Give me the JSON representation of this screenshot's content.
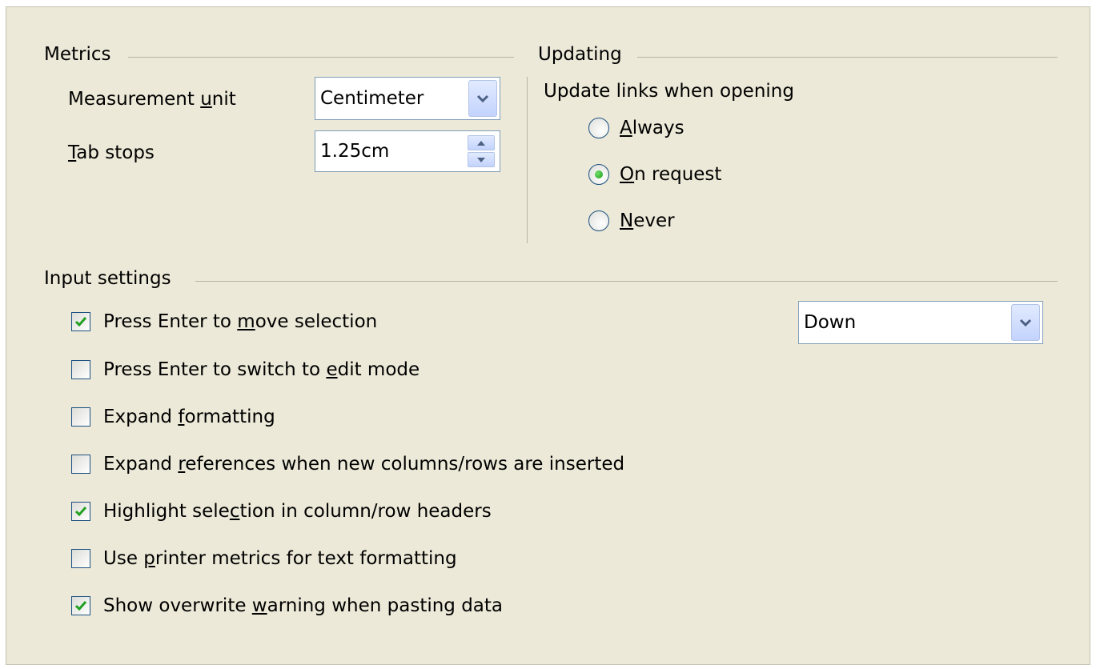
{
  "metrics": {
    "title": "Metrics",
    "measurement_unit": {
      "label_pre": "Measurement ",
      "label_u": "u",
      "label_post": "nit",
      "value": "Centimeter"
    },
    "tab_stops": {
      "label_pre": "",
      "label_u": "T",
      "label_post": "ab stops",
      "value": "1.25cm"
    }
  },
  "updating": {
    "title": "Updating",
    "question": "Update links when opening",
    "options": [
      {
        "pre": "",
        "u": "A",
        "post": "lways",
        "selected": false
      },
      {
        "pre": "",
        "u": "O",
        "post": "n request",
        "selected": true
      },
      {
        "pre": "",
        "u": "N",
        "post": "ever",
        "selected": false
      }
    ]
  },
  "input_settings": {
    "title": "Input settings",
    "direction_value": "Down",
    "options": [
      {
        "pre": "Press Enter to ",
        "u": "m",
        "post": "ove selection",
        "checked": true
      },
      {
        "pre": "Press Enter to switch to ",
        "u": "e",
        "post": "dit mode",
        "checked": false
      },
      {
        "pre": "Expand ",
        "u": "f",
        "post": "ormatting",
        "checked": false
      },
      {
        "pre": "Expand ",
        "u": "r",
        "post": "eferences when new columns/rows are inserted",
        "checked": false
      },
      {
        "pre": "Highlight sele",
        "u": "c",
        "post": "tion in column/row headers",
        "checked": true
      },
      {
        "pre": "Use ",
        "u": "p",
        "post": "rinter metrics for text formatting",
        "checked": false
      },
      {
        "pre": "Show overwrite ",
        "u": "w",
        "post": "arning when pasting data",
        "checked": true
      }
    ]
  },
  "colors": {
    "panel": "#ECE9D8",
    "field_border": "#7f9db9",
    "check": "#21a121"
  }
}
